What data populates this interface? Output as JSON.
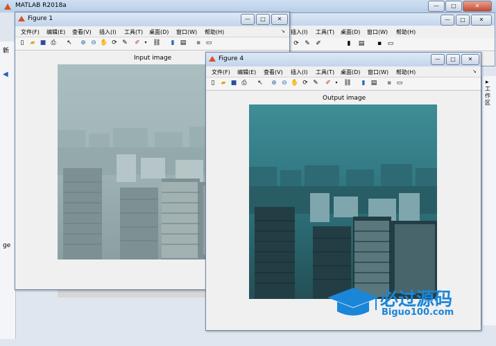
{
  "matlab": {
    "title": "MATLAB R2018a",
    "menu": [
      "插入(I)",
      "工具(T)",
      "桌面(D)",
      "窗口(W)",
      "帮助(H)"
    ],
    "left_strip_texts": [
      "新",
      "ge"
    ],
    "right_strip_text": "工作区"
  },
  "caption_buttons": {
    "minimize": "—",
    "maximize": "□",
    "close": "✕"
  },
  "figure1": {
    "title": "Figure 1",
    "menu": [
      "文件(F)",
      "编辑(E)",
      "查看(V)",
      "插入(I)",
      "工具(T)",
      "桌面(D)",
      "窗口(W)",
      "帮助(H)"
    ],
    "axes_title": "Input image",
    "image_tint": "#9fb4b8"
  },
  "figure4": {
    "title": "Figure 4",
    "menu": [
      "文件(F)",
      "编辑(E)",
      "查看(V)",
      "插入(I)",
      "工具(T)",
      "桌面(D)",
      "窗口(W)",
      "帮助(H)"
    ],
    "axes_title": "Output image",
    "image_tint": "#3d7b86"
  },
  "toolbar_icons": [
    "new-figure-icon",
    "open-file-icon",
    "save-icon",
    "print-icon",
    "pointer-icon",
    "zoom-in-icon",
    "zoom-out-icon",
    "pan-icon",
    "rotate-icon",
    "data-cursor-icon",
    "brush-icon",
    "link-icon",
    "insert-colorbar-icon",
    "insert-legend-icon",
    "hide-plot-tools-icon",
    "show-plot-tools-icon"
  ],
  "watermark": {
    "line1": "必过源码",
    "line2": "Biguo100.com",
    "color": "#1a86d8"
  }
}
